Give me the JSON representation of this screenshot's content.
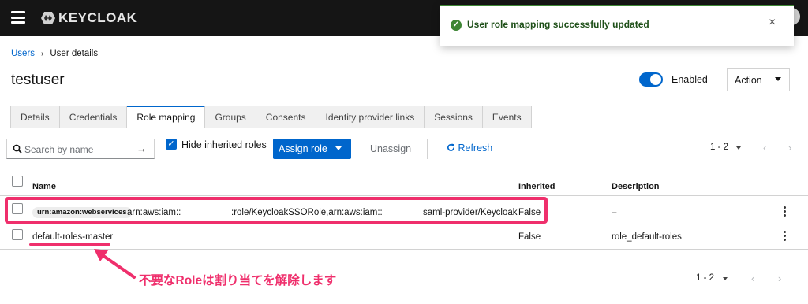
{
  "app": {
    "name": "KEYCLOAK"
  },
  "toast": {
    "message": "User role mapping successfully updated",
    "close": "×"
  },
  "breadcrumb": {
    "users": "Users",
    "separator": "›",
    "current": "User details"
  },
  "page": {
    "title": "testuser"
  },
  "header_controls": {
    "enabled_label": "Enabled",
    "enabled_state": true,
    "action_label": "Action"
  },
  "tabs": [
    {
      "label": "Details",
      "active": false
    },
    {
      "label": "Credentials",
      "active": false
    },
    {
      "label": "Role mapping",
      "active": true
    },
    {
      "label": "Groups",
      "active": false
    },
    {
      "label": "Consents",
      "active": false
    },
    {
      "label": "Identity provider links",
      "active": false
    },
    {
      "label": "Sessions",
      "active": false
    },
    {
      "label": "Events",
      "active": false
    }
  ],
  "toolbar": {
    "search_placeholder": "Search by name",
    "hide_inherited_label": "Hide inherited roles",
    "hide_inherited_checked": true,
    "assign_label": "Assign role",
    "unassign_label": "Unassign",
    "refresh_label": "Refresh",
    "pagination": "1 - 2"
  },
  "table": {
    "columns": {
      "name": "Name",
      "inherited": "Inherited",
      "description": "Description"
    },
    "rows": [
      {
        "badge": "urn:amazon:webservices",
        "name_part1": "arn:aws:iam::",
        "name_part2": ":role/KeycloakSSORole,arn:aws:iam::",
        "name_part3": "saml-provider/Keycloak",
        "inherited": "False",
        "description": "–"
      },
      {
        "name": "default-roles-master",
        "inherited": "False",
        "description": "role_default-roles"
      }
    ]
  },
  "pagination_bottom": "1 - 2",
  "annotation": {
    "text": "不要なRoleは割り当てを解除します",
    "color": "#ef2f6c"
  },
  "colors": {
    "accent": "#0066cc",
    "success": "#3e8635",
    "highlight": "#ef2f6c"
  }
}
